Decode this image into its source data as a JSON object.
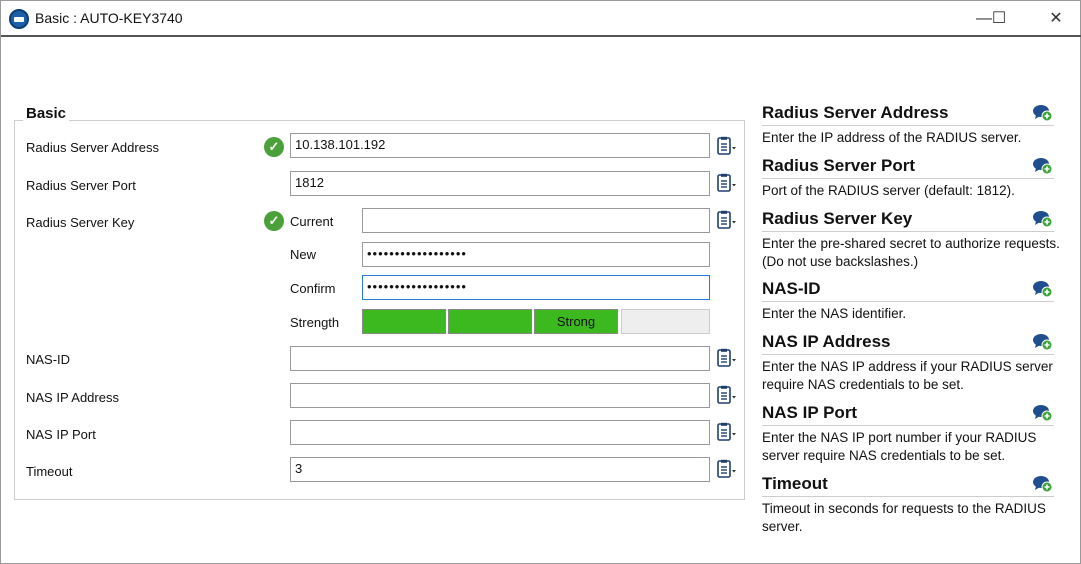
{
  "window": {
    "title": "Basic : AUTO-KEY3740",
    "minimize": "—",
    "maximize": "☐",
    "close": "✕"
  },
  "group_title": "Basic",
  "fields": {
    "radius_server_address": {
      "label": "Radius Server Address",
      "value": "10.138.101.192"
    },
    "radius_server_port": {
      "label": "Radius Server Port",
      "value": "1812"
    },
    "radius_server_key": {
      "label": "Radius Server Key",
      "current_label": "Current",
      "current_value": "",
      "new_label": "New",
      "new_value": "••••••••••••••••••",
      "confirm_label": "Confirm",
      "confirm_value": "••••••••••••••••••",
      "strength_label": "Strength",
      "strength_text": "Strong",
      "strength_level": 0.75
    },
    "nas_id": {
      "label": "NAS-ID",
      "value": ""
    },
    "nas_ip_address": {
      "label": "NAS IP Address",
      "value": ""
    },
    "nas_ip_port": {
      "label": "NAS IP Port",
      "value": ""
    },
    "timeout": {
      "label": "Timeout",
      "value": "3"
    }
  },
  "help": [
    {
      "title": "Radius Server Address",
      "text": "Enter the IP address of the RADIUS server."
    },
    {
      "title": "Radius Server Port",
      "text": "Port of the RADIUS server (default: 1812)."
    },
    {
      "title": "Radius Server Key",
      "text": "Enter the pre-shared secret to authorize requests. (Do not use backslashes.)"
    },
    {
      "title": "NAS-ID",
      "text": "Enter the NAS identifier."
    },
    {
      "title": "NAS IP Address",
      "text": "Enter the NAS IP address if your RADIUS server require NAS credentials to be set."
    },
    {
      "title": "NAS IP Port",
      "text": "Enter the NAS IP port number if your RADIUS server require NAS credentials to be set."
    },
    {
      "title": "Timeout",
      "text": "Timeout in seconds for requests to the RADIUS server."
    }
  ],
  "colors": {
    "strength_fill": "#3cb91e",
    "check": "#4aa13a",
    "focus": "#2b7cd3"
  }
}
